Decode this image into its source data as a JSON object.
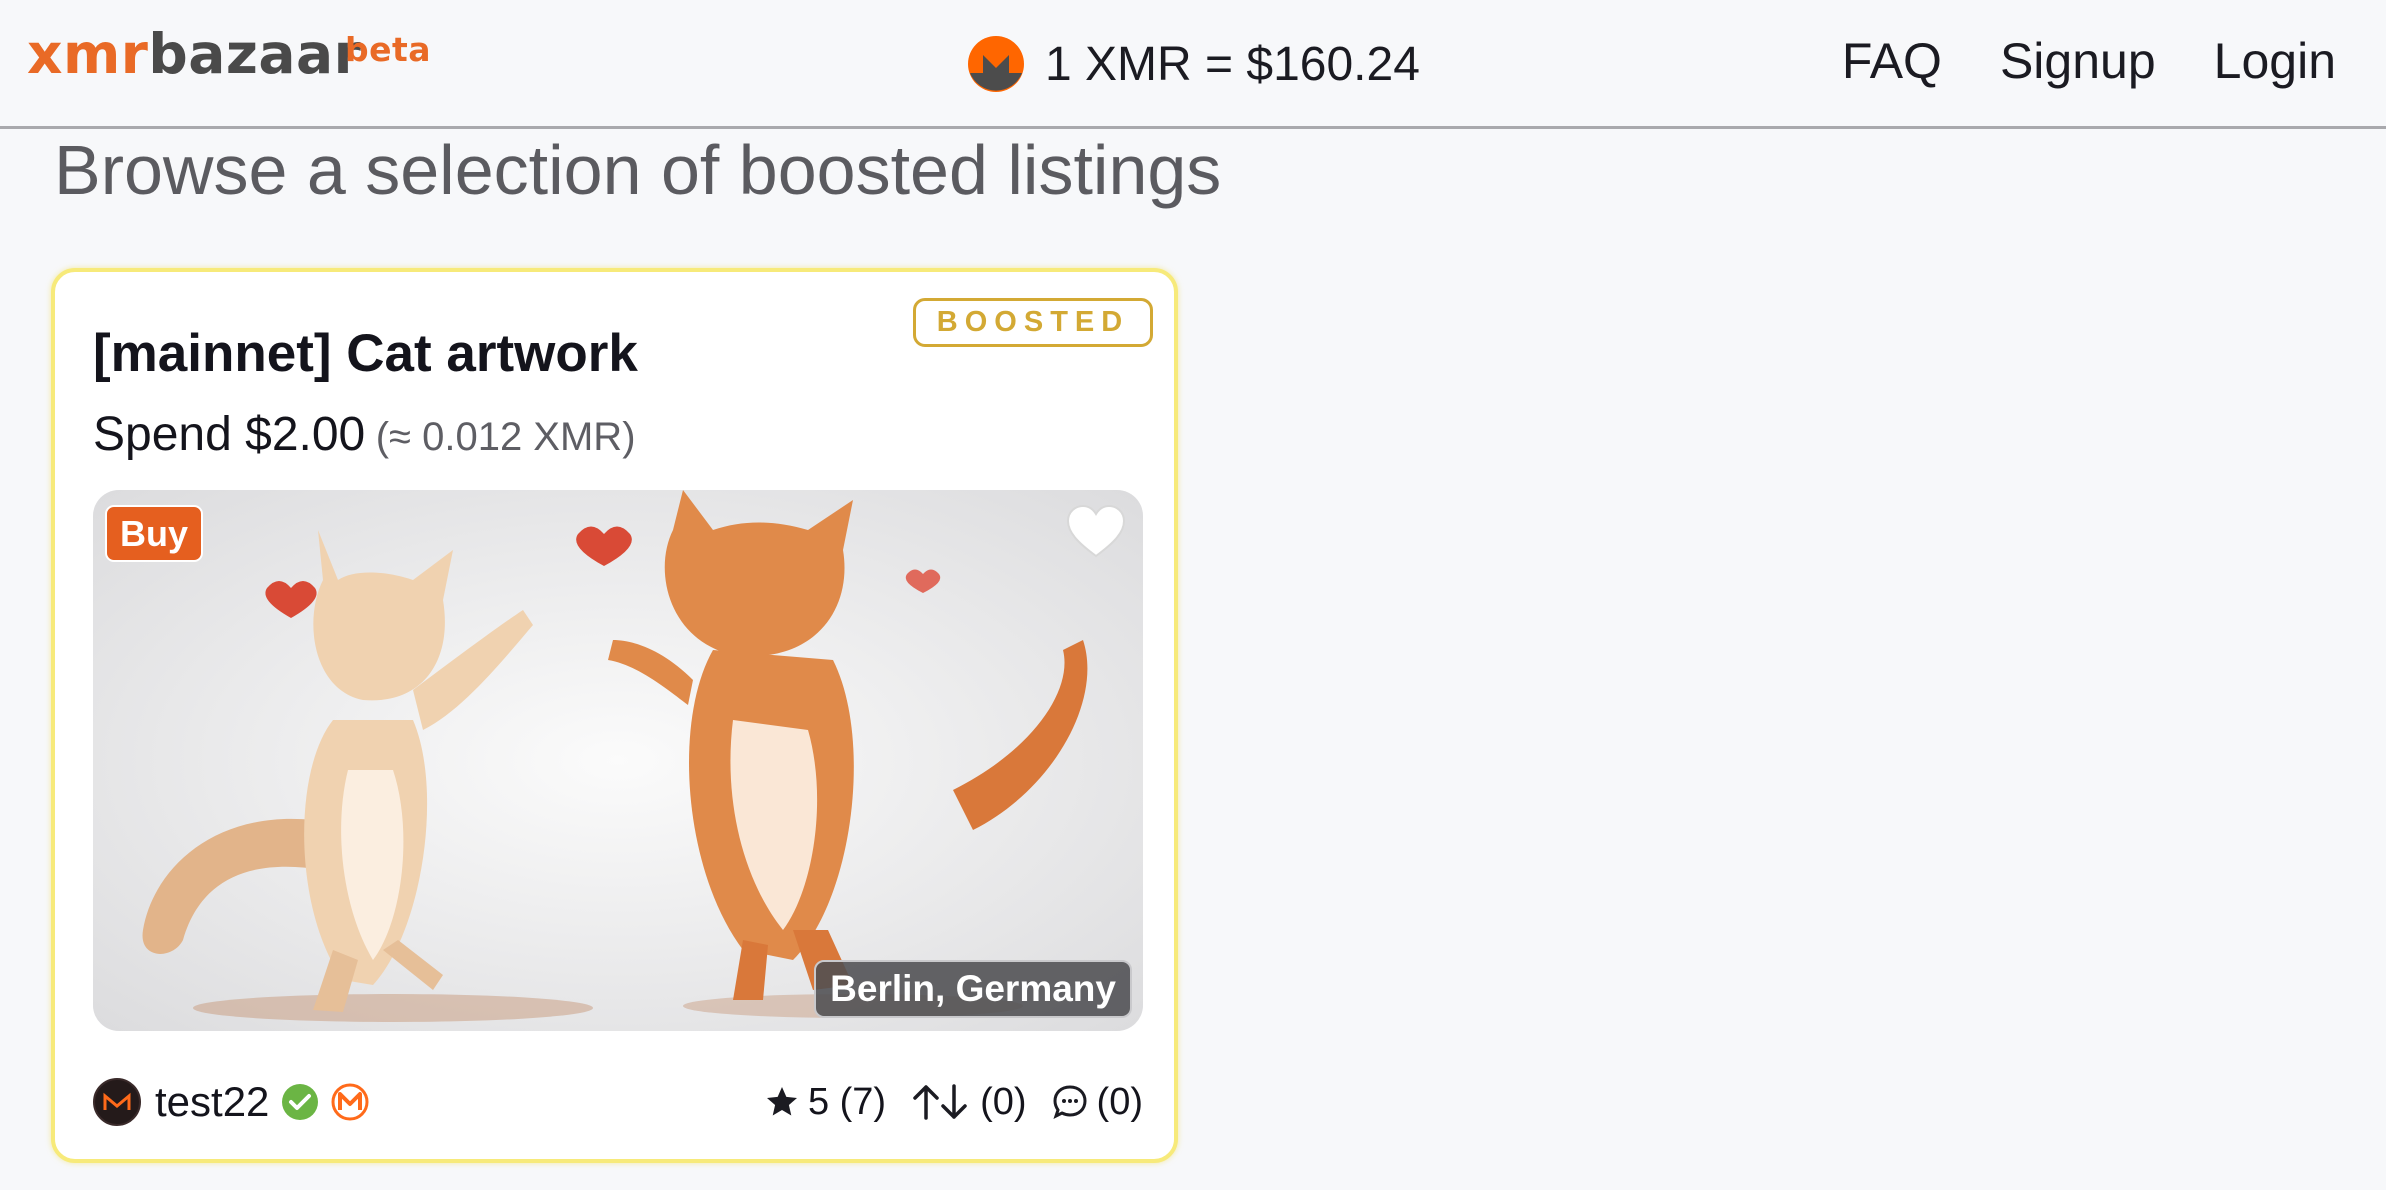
{
  "header": {
    "logo": {
      "part1": "xmr",
      "part2": "bazaar",
      "tag": "beta"
    },
    "rate": "1 XMR = $160.24",
    "nav": [
      "FAQ",
      "Signup",
      "Login"
    ]
  },
  "page": {
    "title": "Browse a selection of boosted listings"
  },
  "listing": {
    "badge": "BOOSTED",
    "title": "[mainnet] Cat artwork",
    "price": "Spend $2.00",
    "price_xmr": "(≈ 0.012 XMR)",
    "buy_label": "Buy",
    "location": "Berlin, Germany",
    "seller": "test22",
    "rating": "5 (7)",
    "trades": "(0)",
    "comments": "(0)"
  },
  "colors": {
    "brand_orange": "#e96a26",
    "boosted_gold": "#d3a934",
    "card_border": "#f7ea7a",
    "verified_green": "#6bb544"
  },
  "icons": [
    "monero-icon",
    "heart-icon",
    "verified-icon",
    "monero-badge-icon",
    "star-icon",
    "up-down-arrows-icon",
    "comment-icon"
  ]
}
